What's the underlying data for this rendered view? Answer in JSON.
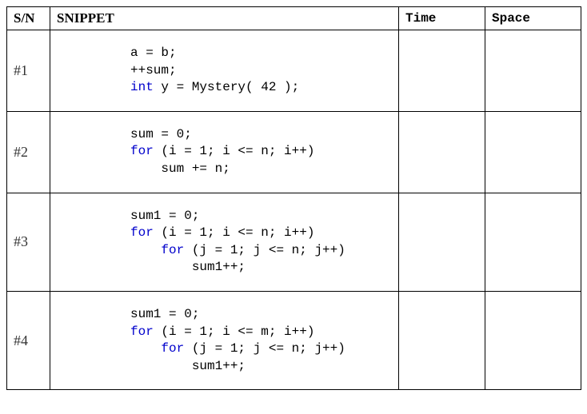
{
  "headers": {
    "sn": "S/N",
    "snippet": "SNIPPET",
    "time": "Time",
    "space": "Space"
  },
  "rows": [
    {
      "sn": "#1",
      "code": [
        {
          "indent": 0,
          "tokens": [
            {
              "t": "a = b;"
            }
          ]
        },
        {
          "indent": 0,
          "tokens": [
            {
              "t": "++sum;"
            }
          ]
        },
        {
          "indent": 0,
          "tokens": [
            {
              "t": "int",
              "kw": true
            },
            {
              "t": " y = Mystery( 42 );"
            }
          ]
        }
      ],
      "time": "",
      "space": ""
    },
    {
      "sn": "#2",
      "code": [
        {
          "indent": 0,
          "tokens": [
            {
              "t": "sum = 0;"
            }
          ]
        },
        {
          "indent": 0,
          "tokens": [
            {
              "t": "for",
              "kw": true
            },
            {
              "t": " (i = 1; i <= n; i++)"
            }
          ]
        },
        {
          "indent": 1,
          "tokens": [
            {
              "t": "sum += n;"
            }
          ]
        }
      ],
      "time": "",
      "space": ""
    },
    {
      "sn": "#3",
      "code": [
        {
          "indent": 0,
          "tokens": [
            {
              "t": "sum1 = 0;"
            }
          ]
        },
        {
          "indent": 0,
          "tokens": [
            {
              "t": "for",
              "kw": true
            },
            {
              "t": " (i = 1; i <= n; i++)"
            }
          ]
        },
        {
          "indent": 1,
          "tokens": [
            {
              "t": "for",
              "kw": true
            },
            {
              "t": " (j = 1; j <= n; j++)"
            }
          ]
        },
        {
          "indent": 2,
          "tokens": [
            {
              "t": "sum1++;"
            }
          ]
        }
      ],
      "time": "",
      "space": ""
    },
    {
      "sn": "#4",
      "code": [
        {
          "indent": 0,
          "tokens": [
            {
              "t": "sum1 = 0;"
            }
          ]
        },
        {
          "indent": 0,
          "tokens": [
            {
              "t": "for",
              "kw": true
            },
            {
              "t": " (i = 1; i <= m; i++)"
            }
          ]
        },
        {
          "indent": 1,
          "tokens": [
            {
              "t": "for",
              "kw": true
            },
            {
              "t": " (j = 1; j <= n; j++)"
            }
          ]
        },
        {
          "indent": 2,
          "tokens": [
            {
              "t": "sum1++;"
            }
          ]
        }
      ],
      "time": "",
      "space": ""
    }
  ],
  "indent_unit": "    "
}
